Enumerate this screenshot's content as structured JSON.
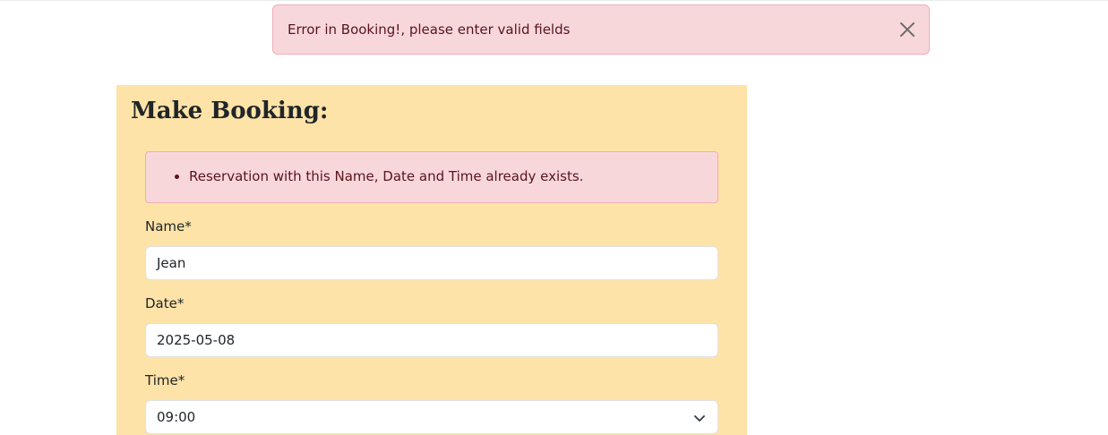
{
  "alert": {
    "message": "Error in Booking!, please enter valid fields",
    "close_icon": "close-icon"
  },
  "form": {
    "title": "Make Booking:",
    "errors": [
      "Reservation with this Name, Date and Time already exists."
    ],
    "fields": {
      "name": {
        "label": "Name*",
        "value": "Jean"
      },
      "date": {
        "label": "Date*",
        "value": "2025-05-08"
      },
      "time": {
        "label": "Time*",
        "value": "09:00",
        "icon": "chevron-down-icon"
      }
    }
  },
  "colors": {
    "alert_bg": "#f8d7da",
    "alert_text": "#58151c",
    "card_bg": "#fde3a7"
  }
}
